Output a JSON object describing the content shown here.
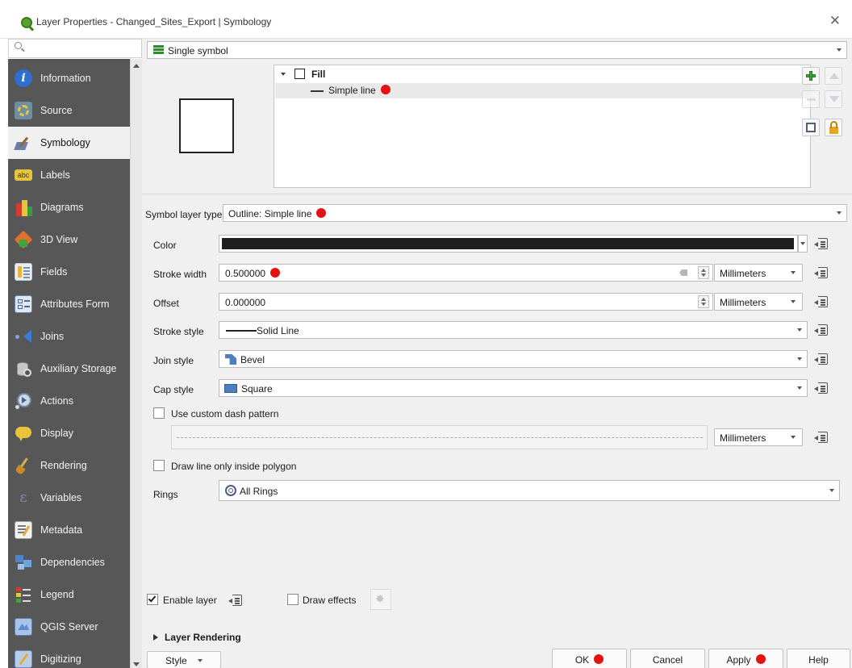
{
  "window": {
    "title": "Layer Properties - Changed_Sites_Export | Symbology",
    "close_glyph": "✕"
  },
  "sidebar": {
    "search_placeholder": "",
    "items": [
      {
        "label": "Information",
        "icon": "information-icon"
      },
      {
        "label": "Source",
        "icon": "source-icon"
      },
      {
        "label": "Symbology",
        "icon": "symbology-icon",
        "active": true
      },
      {
        "label": "Labels",
        "icon": "labels-icon"
      },
      {
        "label": "Diagrams",
        "icon": "diagrams-icon"
      },
      {
        "label": "3D View",
        "icon": "3d-view-icon"
      },
      {
        "label": "Fields",
        "icon": "fields-icon"
      },
      {
        "label": "Attributes Form",
        "icon": "attributes-form-icon"
      },
      {
        "label": "Joins",
        "icon": "joins-icon"
      },
      {
        "label": "Auxiliary Storage",
        "icon": "auxiliary-storage-icon"
      },
      {
        "label": "Actions",
        "icon": "actions-icon"
      },
      {
        "label": "Display",
        "icon": "display-icon"
      },
      {
        "label": "Rendering",
        "icon": "rendering-icon"
      },
      {
        "label": "Variables",
        "icon": "variables-icon"
      },
      {
        "label": "Metadata",
        "icon": "metadata-icon"
      },
      {
        "label": "Dependencies",
        "icon": "dependencies-icon"
      },
      {
        "label": "Legend",
        "icon": "legend-icon"
      },
      {
        "label": "QGIS Server",
        "icon": "qgis-server-icon"
      },
      {
        "label": "Digitizing",
        "icon": "digitizing-icon"
      }
    ],
    "labels_icon_text": "abc"
  },
  "renderer": {
    "type_label": "Single symbol"
  },
  "symbol_tree": {
    "root_label": "Fill",
    "child_label": "Simple line"
  },
  "symbol_layer": {
    "type_label": "Symbol layer type",
    "type_value": "Outline: Simple line"
  },
  "properties": {
    "color_label": "Color",
    "color_value": "#1f1f1f",
    "stroke_width_label": "Stroke width",
    "stroke_width_value": "0.500000",
    "stroke_width_unit": "Millimeters",
    "offset_label": "Offset",
    "offset_value": "0.000000",
    "offset_unit": "Millimeters",
    "stroke_style_label": "Stroke style",
    "stroke_style_value": "Solid Line",
    "join_style_label": "Join style",
    "join_style_value": "Bevel",
    "cap_style_label": "Cap style",
    "cap_style_value": "Square",
    "custom_dash_label": "Use custom dash pattern",
    "dash_unit": "Millimeters",
    "draw_inside_label": "Draw line only inside polygon",
    "rings_label": "Rings",
    "rings_value": "All Rings"
  },
  "layer_options": {
    "enable_layer_label": "Enable layer",
    "draw_effects_label": "Draw effects",
    "layer_rendering_label": "Layer Rendering"
  },
  "footer": {
    "style_label": "Style",
    "ok_label": "OK",
    "cancel_label": "Cancel",
    "apply_label": "Apply",
    "help_label": "Help"
  },
  "colors": {
    "annotation_dot": "#e51212",
    "sidebar_bg": "#575757",
    "accent_green": "#5aa02c"
  }
}
